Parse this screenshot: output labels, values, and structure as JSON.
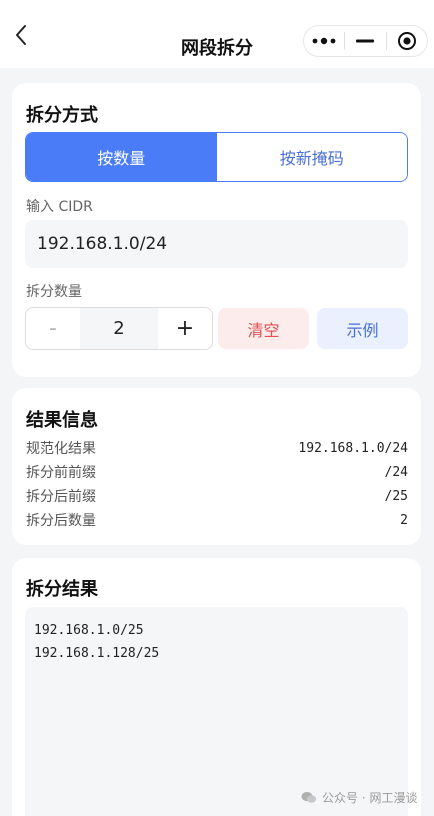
{
  "nav": {
    "title": "网段拆分"
  },
  "split_mode": {
    "title": "拆分方式",
    "options": [
      "按数量",
      "按新掩码"
    ],
    "selected": "按数量",
    "cidr_label": "输入 CIDR",
    "cidr_value": "192.168.1.0/24",
    "count_label": "拆分数量",
    "stepper_minus": "-",
    "stepper_value": "2",
    "stepper_plus": "+",
    "clear_label": "清空",
    "example_label": "示例"
  },
  "result_info": {
    "title": "结果信息",
    "rows": [
      {
        "key": "规范化结果",
        "value": "192.168.1.0/24"
      },
      {
        "key": "拆分前前缀",
        "value": "/24"
      },
      {
        "key": "拆分后前缀",
        "value": "/25"
      },
      {
        "key": "拆分后数量",
        "value": "2"
      }
    ]
  },
  "split_result": {
    "title": "拆分结果",
    "lines": [
      "192.168.1.0/25",
      "192.168.1.128/25"
    ]
  },
  "watermark": {
    "text": "公众号 · 网工漫谈"
  },
  "colors": {
    "accent": "#4a7cf7",
    "clear_bg": "#fdecec",
    "clear_text": "#e05050",
    "example_bg": "#eaf0fd"
  }
}
